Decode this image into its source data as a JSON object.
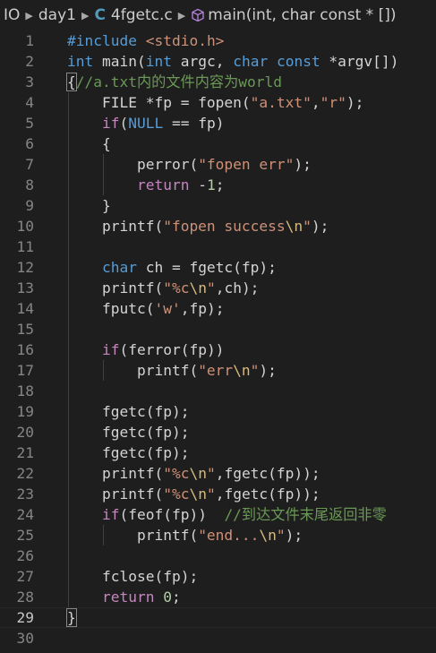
{
  "breadcrumb": {
    "items": [
      "IO",
      "day1",
      "4fgetc.c",
      "main(int, char const * [])"
    ],
    "file_icon": "C",
    "symbol_icon": "cube-icon"
  },
  "active_line": 29,
  "lines": [
    {
      "n": "1",
      "tokens": [
        [
          "kw",
          "#include"
        ],
        [
          "",
          " "
        ],
        [
          "str",
          "<stdio.h>"
        ]
      ]
    },
    {
      "n": "2",
      "tokens": [
        [
          "kw",
          "int"
        ],
        [
          "",
          " main("
        ],
        [
          "kw",
          "int"
        ],
        [
          "",
          " argc, "
        ],
        [
          "kw",
          "char"
        ],
        [
          "",
          " "
        ],
        [
          "kw",
          "const"
        ],
        [
          "",
          " *argv[]"
        ],
        [
          "",
          ")"
        ]
      ]
    },
    {
      "n": "3",
      "tokens": [
        [
          "brk",
          "{"
        ],
        [
          "cm",
          "//a.txt内的文件内容为world"
        ]
      ]
    },
    {
      "n": "4",
      "tokens": [
        [
          "",
          "    FILE *fp = fopen("
        ],
        [
          "str",
          "\"a.txt\""
        ],
        [
          "",
          ","
        ],
        [
          "str",
          "\"r\""
        ],
        [
          "",
          ");"
        ]
      ]
    },
    {
      "n": "5",
      "tokens": [
        [
          "",
          "    "
        ],
        [
          "kw2",
          "if"
        ],
        [
          "",
          "("
        ],
        [
          "kw",
          "NULL"
        ],
        [
          "",
          " == fp)"
        ]
      ]
    },
    {
      "n": "6",
      "tokens": [
        [
          "",
          "    {"
        ]
      ]
    },
    {
      "n": "7",
      "tokens": [
        [
          "",
          "        perror("
        ],
        [
          "str",
          "\"fopen err\""
        ],
        [
          "",
          ");"
        ]
      ]
    },
    {
      "n": "8",
      "tokens": [
        [
          "",
          "        "
        ],
        [
          "kw2",
          "return"
        ],
        [
          "",
          " -"
        ],
        [
          "num",
          "1"
        ],
        [
          "",
          ";"
        ]
      ]
    },
    {
      "n": "9",
      "tokens": [
        [
          "",
          "    }"
        ]
      ]
    },
    {
      "n": "10",
      "tokens": [
        [
          "",
          "    printf("
        ],
        [
          "str",
          "\"fopen success"
        ],
        [
          "esc",
          "\\n"
        ],
        [
          "str",
          "\""
        ],
        [
          "",
          ");"
        ]
      ]
    },
    {
      "n": "11",
      "tokens": []
    },
    {
      "n": "12",
      "tokens": [
        [
          "",
          "    "
        ],
        [
          "kw",
          "char"
        ],
        [
          "",
          " ch = fgetc(fp);"
        ]
      ]
    },
    {
      "n": "13",
      "tokens": [
        [
          "",
          "    printf("
        ],
        [
          "str",
          "\"%c"
        ],
        [
          "esc",
          "\\n"
        ],
        [
          "str",
          "\""
        ],
        [
          "",
          ",ch);"
        ]
      ]
    },
    {
      "n": "14",
      "tokens": [
        [
          "",
          "    fputc("
        ],
        [
          "str",
          "'w'"
        ],
        [
          "",
          ",fp);"
        ]
      ]
    },
    {
      "n": "15",
      "tokens": []
    },
    {
      "n": "16",
      "tokens": [
        [
          "",
          "    "
        ],
        [
          "kw2",
          "if"
        ],
        [
          "",
          "(ferror(fp))"
        ]
      ]
    },
    {
      "n": "17",
      "tokens": [
        [
          "",
          "        printf("
        ],
        [
          "str",
          "\"err"
        ],
        [
          "esc",
          "\\n"
        ],
        [
          "str",
          "\""
        ],
        [
          "",
          ");"
        ]
      ]
    },
    {
      "n": "18",
      "tokens": []
    },
    {
      "n": "19",
      "tokens": [
        [
          "",
          "    fgetc(fp);"
        ]
      ]
    },
    {
      "n": "20",
      "tokens": [
        [
          "",
          "    fgetc(fp);"
        ]
      ]
    },
    {
      "n": "21",
      "tokens": [
        [
          "",
          "    fgetc(fp);"
        ]
      ]
    },
    {
      "n": "22",
      "tokens": [
        [
          "",
          "    printf("
        ],
        [
          "str",
          "\"%c"
        ],
        [
          "esc",
          "\\n"
        ],
        [
          "str",
          "\""
        ],
        [
          "",
          ",fgetc(fp));"
        ]
      ]
    },
    {
      "n": "23",
      "tokens": [
        [
          "",
          "    printf("
        ],
        [
          "str",
          "\"%c"
        ],
        [
          "esc",
          "\\n"
        ],
        [
          "str",
          "\""
        ],
        [
          "",
          ",fgetc(fp));"
        ]
      ]
    },
    {
      "n": "24",
      "tokens": [
        [
          "",
          "    "
        ],
        [
          "kw2",
          "if"
        ],
        [
          "",
          "(feof(fp))  "
        ],
        [
          "cm",
          "//到达文件末尾返回非零"
        ]
      ]
    },
    {
      "n": "25",
      "tokens": [
        [
          "",
          "        printf("
        ],
        [
          "str",
          "\"end..."
        ],
        [
          "esc",
          "\\n"
        ],
        [
          "str",
          "\""
        ],
        [
          "",
          ");"
        ]
      ]
    },
    {
      "n": "26",
      "tokens": []
    },
    {
      "n": "27",
      "tokens": [
        [
          "",
          "    fclose(fp);"
        ]
      ]
    },
    {
      "n": "28",
      "tokens": [
        [
          "",
          "    "
        ],
        [
          "kw2",
          "return"
        ],
        [
          "",
          " "
        ],
        [
          "num",
          "0"
        ],
        [
          "",
          ";"
        ]
      ]
    },
    {
      "n": "29",
      "tokens": [
        [
          "brk",
          "}"
        ]
      ]
    },
    {
      "n": "30",
      "tokens": []
    }
  ]
}
